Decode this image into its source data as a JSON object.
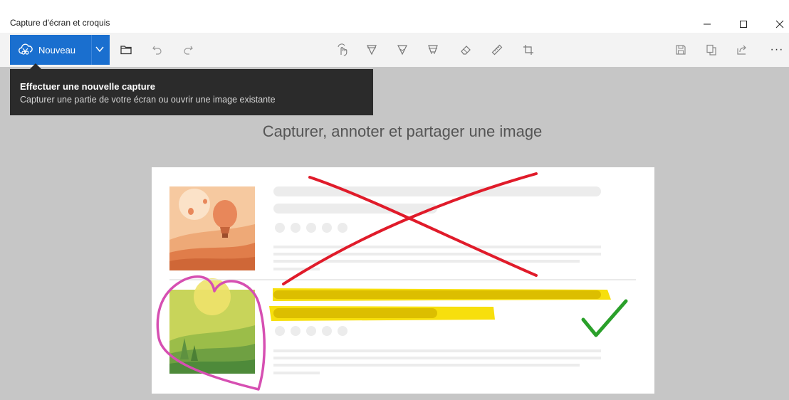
{
  "window": {
    "title": "Capture d'écran et croquis"
  },
  "toolbar": {
    "new_label": "Nouveau",
    "more_label": "···"
  },
  "tooltip": {
    "title": "Effectuer une nouvelle capture",
    "description": "Capturer une partie de votre écran ou ouvrir une image existante"
  },
  "main": {
    "headline": "Capturer, annoter et partager une image"
  },
  "colors": {
    "accent": "#1a6fcf",
    "canvas": "#c6c6c6",
    "tooltip": "#2b2b2b",
    "cross": "#e01b2a",
    "heart": "#d64fb2",
    "highlight": "#f7dd00",
    "check": "#2aa02a"
  },
  "icons": [
    "snip-icon",
    "chevron-down-icon",
    "folder-icon",
    "undo-icon",
    "redo-icon",
    "touch-writing-icon",
    "ballpoint-pen-icon",
    "pencil-icon",
    "highlighter-icon",
    "eraser-icon",
    "ruler-icon",
    "crop-icon",
    "save-icon",
    "copy-icon",
    "share-icon",
    "more-icon",
    "minimize-icon",
    "maximize-icon",
    "close-icon"
  ]
}
